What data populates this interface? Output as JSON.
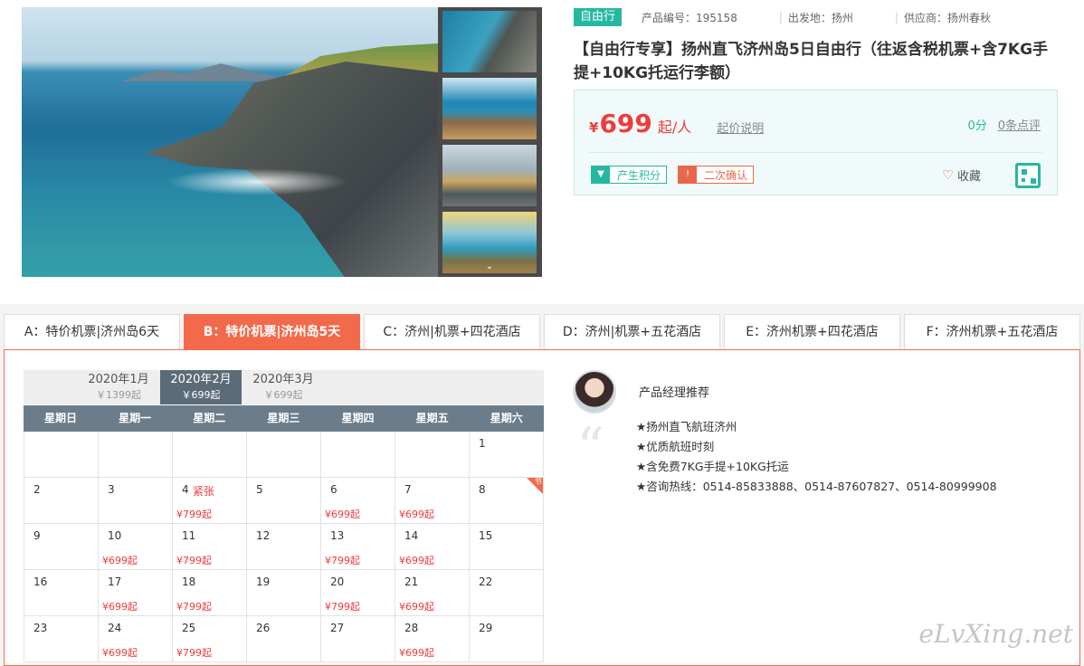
{
  "product": {
    "tag": "自由行",
    "code_label": "产品编号：195158",
    "depart_label": "出发地：扬州",
    "supplier_label": "供应商：扬州春秋",
    "title": "【自由行专享】扬州直飞济州岛5日自由行（往返含税机票+含7KG手提+10KG托运行李额）",
    "currency": "¥",
    "price": "699",
    "price_unit": "起/人",
    "price_note": "起价说明",
    "score": "0分",
    "reviews": "0条点评",
    "badge_points": "产生积分",
    "badge_confirm": "二次确认",
    "favorite": "收藏"
  },
  "tabs": [
    {
      "label": "A：特价机票|济州岛6天"
    },
    {
      "label": "B：特价机票|济州岛5天"
    },
    {
      "label": "C：济州|机票+四花酒店"
    },
    {
      "label": "D：济州|机票+五花酒店"
    },
    {
      "label": "E：济州机票+四花酒店"
    },
    {
      "label": "F：济州机票+五花酒店"
    }
  ],
  "calendar": {
    "months": [
      {
        "name": "2020年1月",
        "price": "￥1399起"
      },
      {
        "name": "2020年2月",
        "price": "￥699起"
      },
      {
        "name": "2020年3月",
        "price": "￥699起"
      }
    ],
    "weekdays": [
      "星期日",
      "星期一",
      "星期二",
      "星期三",
      "星期四",
      "星期五",
      "星期六"
    ],
    "rows": [
      [
        {
          "d": ""
        },
        {
          "d": ""
        },
        {
          "d": ""
        },
        {
          "d": ""
        },
        {
          "d": ""
        },
        {
          "d": ""
        },
        {
          "d": "1"
        }
      ],
      [
        {
          "d": "2"
        },
        {
          "d": "3"
        },
        {
          "d": "4",
          "tight": "紧张",
          "p": "¥799起"
        },
        {
          "d": "5"
        },
        {
          "d": "6",
          "p": "¥699起"
        },
        {
          "d": "7",
          "p": "¥699起"
        },
        {
          "d": "8",
          "holiday": "节"
        }
      ],
      [
        {
          "d": "9"
        },
        {
          "d": "10",
          "p": "¥699起"
        },
        {
          "d": "11",
          "p": "¥799起"
        },
        {
          "d": "12"
        },
        {
          "d": "13",
          "p": "¥799起"
        },
        {
          "d": "14",
          "p": "¥699起"
        },
        {
          "d": "15"
        }
      ],
      [
        {
          "d": "16"
        },
        {
          "d": "17",
          "p": "¥699起"
        },
        {
          "d": "18",
          "p": "¥799起"
        },
        {
          "d": "19"
        },
        {
          "d": "20",
          "p": "¥799起"
        },
        {
          "d": "21",
          "p": "¥699起"
        },
        {
          "d": "22"
        }
      ],
      [
        {
          "d": "23"
        },
        {
          "d": "24",
          "p": "¥699起"
        },
        {
          "d": "25",
          "p": "¥799起"
        },
        {
          "d": "26"
        },
        {
          "d": "27"
        },
        {
          "d": "28",
          "p": "¥699起"
        },
        {
          "d": "29"
        }
      ]
    ]
  },
  "manager": {
    "title": "产品经理推荐",
    "items": [
      "★扬州直飞航班济州",
      "★优质航班时刻",
      "★含免费7KG手提+10KG托运",
      "★咨询热线：0514-85833888、0514-87607827、0514-80999908"
    ]
  },
  "watermark": "eLvXing.net",
  "colors": {
    "accent": "#f26a4b",
    "teal": "#25b8a0",
    "price_red": "#f03c3c"
  }
}
